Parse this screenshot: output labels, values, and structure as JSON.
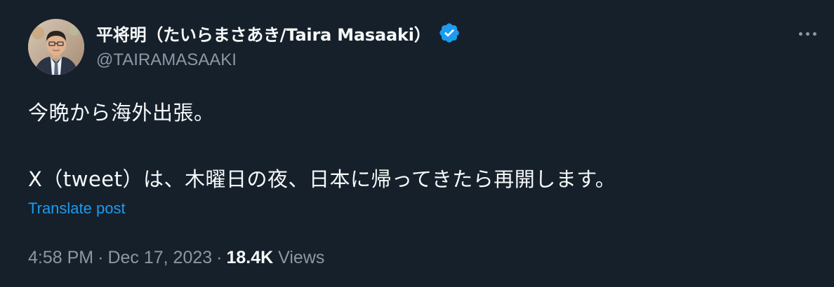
{
  "tweet": {
    "display_name": "平将明（たいらまさあき/Taira Masaaki）",
    "handle": "@TAIRAMASAAKI",
    "text_line1": "今晩から海外出張。",
    "text_line2": "X（tweet）は、木曜日の夜、日本に帰ってきたら再開します。",
    "translate_label": "Translate post",
    "time": "4:58 PM",
    "separator": "·",
    "date": "Dec 17, 2023",
    "views_count": "18.4K",
    "views_label": "Views"
  },
  "icons": {
    "verified": "verified-badge-icon",
    "more": "more-options-icon"
  },
  "colors": {
    "background": "#15202b",
    "primary_text": "#f7f9f9",
    "secondary_text": "#8b98a5",
    "accent": "#1d9bf0"
  }
}
